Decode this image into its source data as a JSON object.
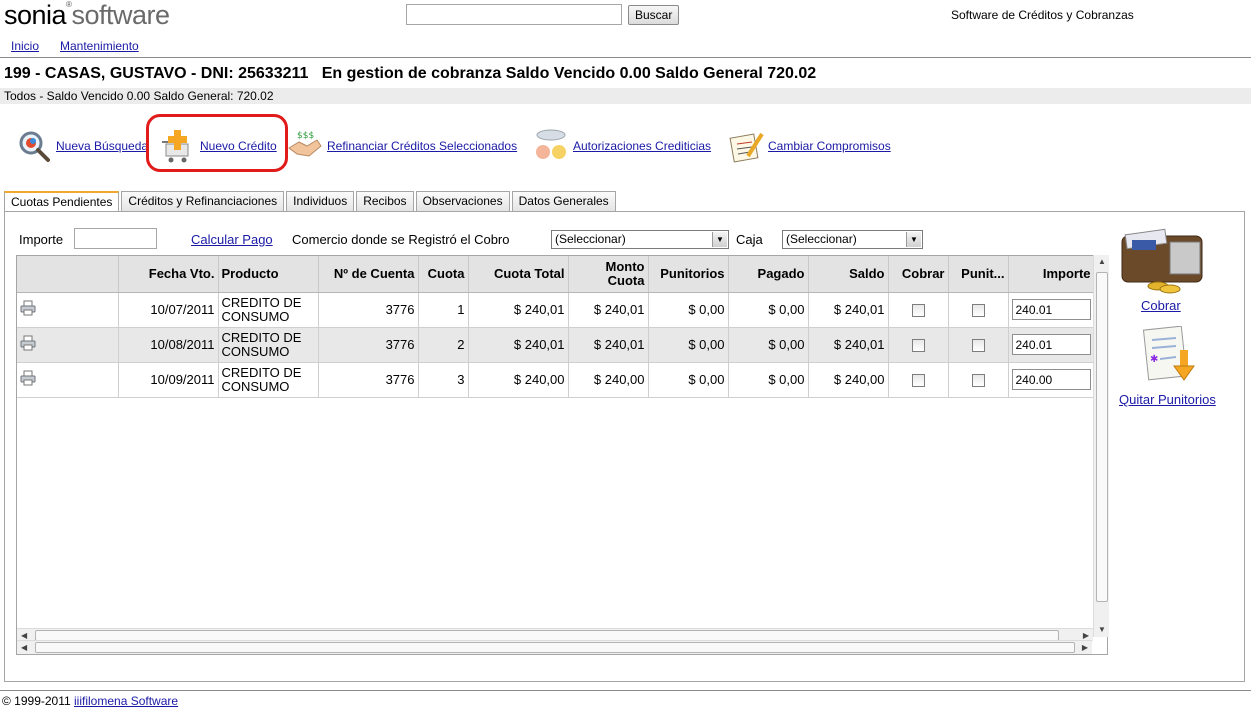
{
  "header": {
    "logo_part1": "sonia",
    "logo_reg": "®",
    "logo_part2": "software",
    "search_placeholder": "",
    "search_button": "Buscar",
    "tagline": "Software de Créditos y Cobranzas"
  },
  "menu": [
    "Inicio",
    "Mantenimiento"
  ],
  "client": {
    "title": "199 - CASAS, GUSTAVO - DNI: 25633211   En gestion de cobranza Saldo Vencido 0.00 Saldo General 720.02",
    "summary": "Todos - Saldo Vencido 0.00 Saldo General: 720.02"
  },
  "toolbar": {
    "nueva_busqueda": "Nueva Búsqueda",
    "nuevo_credito": "Nuevo Crédito",
    "refinanciar": "Refinanciar Créditos Seleccionados",
    "autorizaciones": "Autorizaciones Crediticias",
    "compromisos": "Cambiar Compromisos"
  },
  "tabs": [
    "Cuotas Pendientes",
    "Créditos y Refinanciaciones",
    "Individuos",
    "Recibos",
    "Observaciones",
    "Datos Generales"
  ],
  "filters": {
    "importe_label": "Importe",
    "importe_value": "",
    "calcular_link": "Calcular Pago",
    "comercio_label": "Comercio donde se Registró el Cobro",
    "comercio_value": "(Seleccionar)",
    "caja_label": "Caja",
    "caja_value": "(Seleccionar)"
  },
  "grid": {
    "columns": [
      "",
      "Fecha Vto.",
      "Producto",
      "Nº de Cuenta",
      "Cuota",
      "Cuota Total",
      "Monto Cuota",
      "Punitorios",
      "Pagado",
      "Saldo",
      "Cobrar",
      "Punit...",
      "Importe"
    ],
    "rows": [
      {
        "fecha": "10/07/2011",
        "producto": "CREDITO DE CONSUMO",
        "cuenta": "3776",
        "cuota": "1",
        "cuota_total": "$ 240,01",
        "monto": "$ 240,01",
        "punitorios": "$ 0,00",
        "pagado": "$ 0,00",
        "saldo": "$ 240,01",
        "importe": "240.01"
      },
      {
        "fecha": "10/08/2011",
        "producto": "CREDITO DE CONSUMO",
        "cuenta": "3776",
        "cuota": "2",
        "cuota_total": "$ 240,01",
        "monto": "$ 240,01",
        "punitorios": "$ 0,00",
        "pagado": "$ 0,00",
        "saldo": "$ 240,01",
        "importe": "240.01"
      },
      {
        "fecha": "10/09/2011",
        "producto": "CREDITO DE CONSUMO",
        "cuenta": "3776",
        "cuota": "3",
        "cuota_total": "$ 240,00",
        "monto": "$ 240,00",
        "punitorios": "$ 0,00",
        "pagado": "$ 0,00",
        "saldo": "$ 240,00",
        "importe": "240.00"
      }
    ]
  },
  "side": {
    "cobrar": "Cobrar",
    "quitar": "Quitar Punitorios"
  },
  "footer": {
    "copyright": "© 1999-2011",
    "link": "iiifilomena Software"
  },
  "colors": {
    "highlight_circle": "#e11a1a",
    "link": "#1a1aa6",
    "active_tab_top": "#f0a830"
  }
}
